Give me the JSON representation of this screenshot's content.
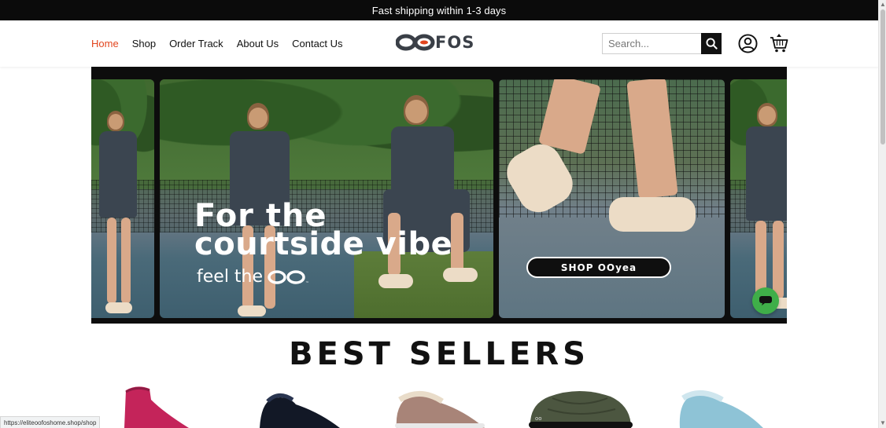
{
  "announcement": {
    "text": "Fast shipping within 1-3 days"
  },
  "nav": {
    "items": [
      {
        "label": "Home",
        "active": true
      },
      {
        "label": "Shop"
      },
      {
        "label": "Order Track"
      },
      {
        "label": "About Us"
      },
      {
        "label": "Contact Us"
      }
    ]
  },
  "brand": {
    "logo_text": "OOFOS"
  },
  "search": {
    "placeholder": "Search..."
  },
  "icons": {
    "search": "search-icon",
    "account": "user-circle-icon",
    "cart": "cart-icon",
    "chat": "chat-icon"
  },
  "hero": {
    "headline_line1": "For the",
    "headline_line2": "courtside vibe",
    "tagline_prefix": "feel the",
    "tagline_mark": "OO",
    "cta_label": "SHOP OOyea"
  },
  "best_sellers": {
    "title": "BEST SELLERS",
    "products": [
      {
        "color": "#c4245a"
      },
      {
        "color": "#121826"
      },
      {
        "color": "#a88478"
      },
      {
        "color": "#4c5640"
      },
      {
        "color": "#8ec3d6"
      }
    ]
  },
  "status_bar": {
    "url": "https://eliteoofoshome.shop/shop"
  },
  "colors": {
    "accent": "#e2451e",
    "announcement_bg": "#0b0b0b",
    "chat_bubble": "#3fae49"
  }
}
